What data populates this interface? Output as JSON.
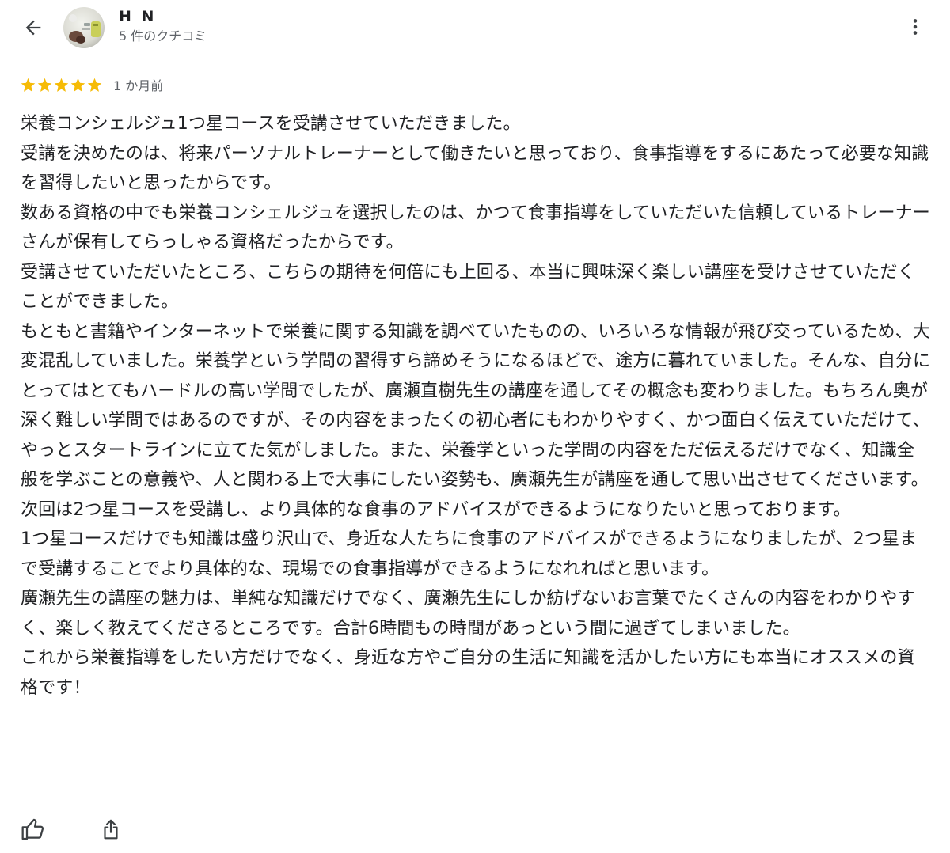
{
  "header": {
    "back_icon": "arrow-back-icon",
    "user_name": "H N",
    "review_count": "5 件のクチコミ",
    "more_icon": "more-vertical-icon"
  },
  "review": {
    "rating": 5,
    "rating_max": 5,
    "star_color": "#f6bb06",
    "date": "1 か月前",
    "paragraphs": [
      "栄養コンシェルジュ1つ星コースを受講させていただきました。",
      "受講を決めたのは、将来パーソナルトレーナーとして働きたいと思っており、食事指導をするにあたって必要な知識を習得したいと思ったからです。",
      "数ある資格の中でも栄養コンシェルジュを選択したのは、かつて食事指導をしていただいた信頼しているトレーナーさんが保有してらっしゃる資格だったからです。",
      "受講させていただいたところ、こちらの期待を何倍にも上回る、本当に興味深く楽しい講座を受けさせていただくことができました。",
      "もともと書籍やインターネットで栄養に関する知識を調べていたものの、いろいろな情報が飛び交っているため、大変混乱していました。栄養学という学問の習得すら諦めそうになるほどで、途方に暮れていました。そんな、自分にとってはとてもハードルの高い学問でしたが、廣瀬直樹先生の講座を通してその概念も変わりました。もちろん奥が深く難しい学問ではあるのですが、その内容をまったくの初心者にもわかりやすく、かつ面白く伝えていただけて、やっとスタートラインに立てた気がしました。また、栄養学といった学問の内容をただ伝えるだけでなく、知識全般を学ぶことの意義や、人と関わる上で大事にしたい姿勢も、廣瀬先生が講座を通して思い出させてくださいます。",
      "次回は2つ星コースを受講し、より具体的な食事のアドバイスができるようになりたいと思っております。",
      "1つ星コースだけでも知識は盛り沢山で、身近な人たちに食事のアドバイスができるようになりましたが、2つ星まで受講することでより具体的な、現場での食事指導ができるようになれればと思います。",
      "廣瀬先生の講座の魅力は、単純な知識だけでなく、廣瀬先生にしか紡げないお言葉でたくさんの内容をわかりやすく、楽しく教えてくださるところです。合計6時間もの時間があっという間に過ぎてしまいました。",
      "これから栄養指導をしたい方だけでなく、身近な方やご自分の生活に知識を活かしたい方にも本当にオススメの資格です！"
    ]
  },
  "actions": {
    "like_icon": "thumbs-up-icon",
    "share_icon": "share-icon"
  }
}
